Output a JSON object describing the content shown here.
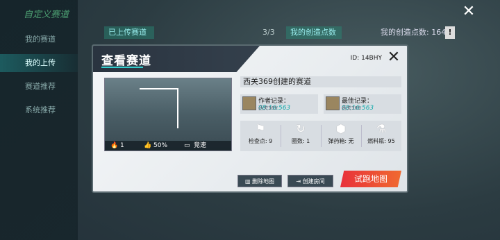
{
  "window": {
    "title": "自定义赛道",
    "close_glyph": "✕"
  },
  "sidebar": {
    "items": [
      {
        "label": "我的赛道",
        "active": false
      },
      {
        "label": "我的上传",
        "active": true
      },
      {
        "label": "赛道推荐",
        "active": false
      },
      {
        "label": "系统推荐",
        "active": false
      }
    ]
  },
  "topbar": {
    "uploaded_tab": "已上传赛道",
    "count": "3/3",
    "creation_points_tab": "我的创造点数",
    "creation_points": "我的创造点数: 164",
    "help_glyph": "!"
  },
  "dialog": {
    "title": "查看赛道",
    "id": "ID: 14BHY",
    "close_glyph": "✕",
    "track_name": "西关369创建的赛道",
    "preview": {
      "likes_count": "1",
      "like_rate": "50%",
      "mode": "竞速"
    },
    "author_record": {
      "label": "作者记录：",
      "time": "08:16:563",
      "player": "西关369"
    },
    "best_record": {
      "label": "最佳记录：",
      "time": "08:16:563",
      "player": "西关369"
    },
    "stats": [
      {
        "icon": "flag-icon",
        "label": "检查点: 9"
      },
      {
        "icon": "loop-icon",
        "label": "圈数: 1"
      },
      {
        "icon": "crate-icon",
        "label": "弹药箱: 无"
      },
      {
        "icon": "fuel-icon",
        "label": "燃料瓶: 95"
      }
    ],
    "buttons": {
      "delete": "删除地图",
      "create_room": "创建房间",
      "test_run": "试跑地图"
    }
  },
  "colors": {
    "accent": "#33cccc",
    "run_button": "#e8303a"
  }
}
